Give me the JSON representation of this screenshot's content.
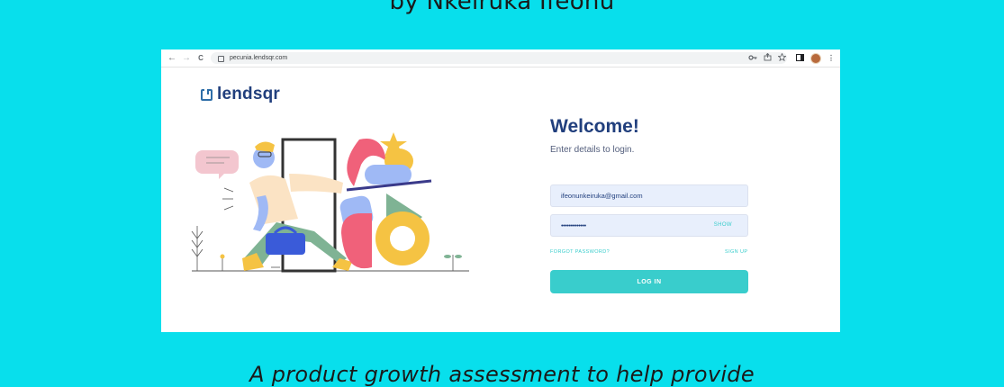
{
  "captions": {
    "top": "by Nkeiruka Ifeonu",
    "bottom": "A product growth assessment to help provide"
  },
  "browser": {
    "url": "pecunia.lendsqr.com",
    "back_icon": "←",
    "forward_icon": "→",
    "reload_icon": "C",
    "right_icons": [
      "key-icon",
      "share-icon",
      "star-icon",
      "sidepanel-icon",
      "avatar",
      "menu-icon"
    ]
  },
  "brand": {
    "name": "lendsqr",
    "accent": "#39cdcc",
    "primary": "#213f7d",
    "background": "#08dfec"
  },
  "login": {
    "title": "Welcome!",
    "subtitle": "Enter details to login.",
    "email_value": "ifeonunkeiruka@gmail.com",
    "password_mask": "•••••••••••••",
    "show_label": "SHOW",
    "forgot_label": "FORGOT PASSWORD?",
    "signup_label": "SIGN UP",
    "login_label": "LOG IN"
  }
}
